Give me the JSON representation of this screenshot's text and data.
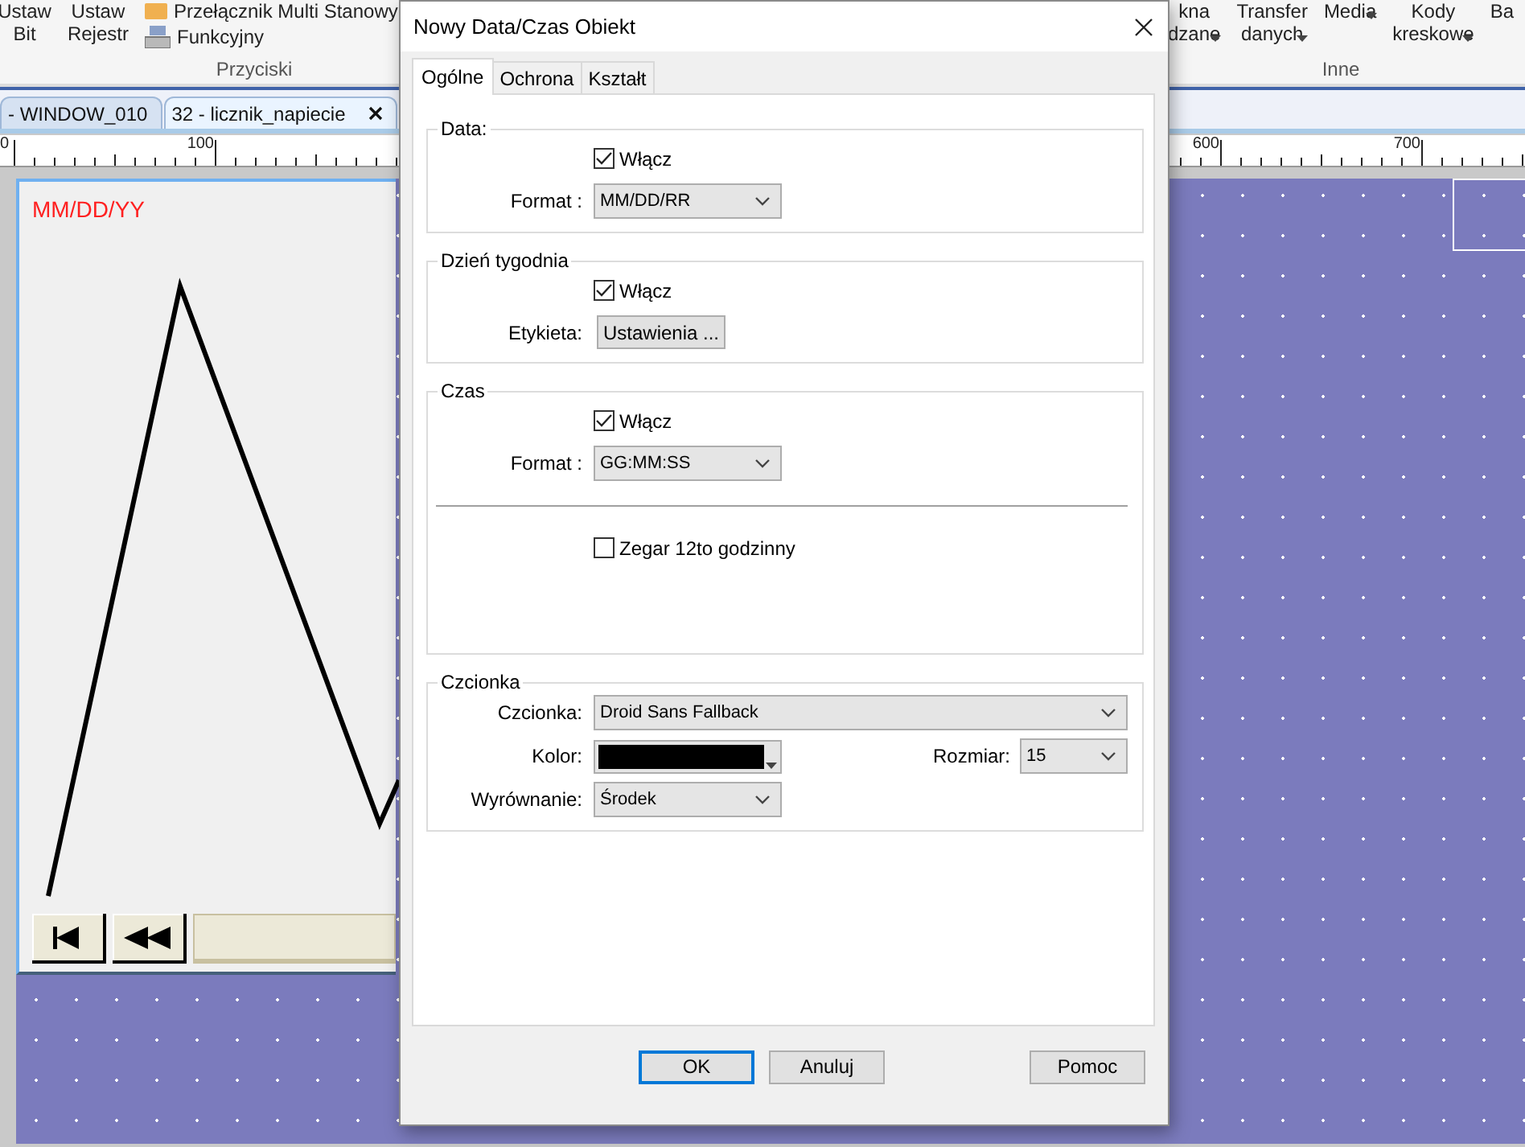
{
  "ribbon": {
    "left_buttons": [
      {
        "lines": [
          "Ustaw",
          "Bit"
        ]
      },
      {
        "lines": [
          "Ustaw",
          "Rejestr"
        ]
      }
    ],
    "small_buttons": [
      "Przełącznik Multi Stanowy",
      "Funkcyjny"
    ],
    "left_group_label": "Przyciski",
    "right_buttons": [
      {
        "lines": [
          "kna",
          "dzane"
        ],
        "dropdown": true
      },
      {
        "lines": [
          "Transfer",
          "danych"
        ],
        "dropdown": true
      },
      {
        "lines": [
          "Media"
        ],
        "dropdown": true
      },
      {
        "lines": [
          "Kody",
          "kreskowe"
        ],
        "dropdown": true
      },
      {
        "lines": [
          "Ba"
        ],
        "dropdown": false
      }
    ],
    "right_group_label": "Inne"
  },
  "doc_tabs": [
    {
      "label": "- WINDOW_010",
      "selected": false
    },
    {
      "label": "32 - licznik_napiecie",
      "selected": true
    }
  ],
  "ruler": {
    "labels": [
      "0",
      "100",
      "600",
      "700"
    ]
  },
  "canvas": {
    "date_text": "MM/DD/YY"
  },
  "dialog": {
    "title": "Nowy Data/Czas Obiekt",
    "tabs": [
      {
        "label": "Ogólne",
        "selected": true
      },
      {
        "label": "Ochrona",
        "selected": false
      },
      {
        "label": "Kształt",
        "selected": false
      }
    ],
    "groups": [
      {
        "legend": "Data:",
        "rows": [
          {
            "kind": "checkbox",
            "label": "Włącz",
            "checked": true
          },
          {
            "kind": "select",
            "label": "Format :",
            "value": "MM/DD/RR"
          }
        ]
      },
      {
        "legend": "Dzień tygodnia",
        "rows": [
          {
            "kind": "checkbox",
            "label": "Włącz",
            "checked": true
          },
          {
            "kind": "button",
            "label": "Etykieta:",
            "value": "Ustawienia ..."
          }
        ]
      },
      {
        "legend": "Czas",
        "rows": [
          {
            "kind": "checkbox",
            "label": "Włącz",
            "checked": true
          },
          {
            "kind": "select",
            "label": "Format :",
            "value": "GG:MM:SS"
          },
          {
            "kind": "separator"
          },
          {
            "kind": "checkbox",
            "label": "Zegar 12to godzinny",
            "checked": false
          }
        ]
      },
      {
        "legend": "Czcionka",
        "rows": [
          {
            "kind": "select",
            "label": "Czcionka:",
            "value": "Droid Sans Fallback",
            "wide": true
          },
          {
            "kind": "color",
            "label": "Kolor:",
            "color": "#000000",
            "size": {
              "label": "Rozmiar:",
              "value": "15"
            }
          },
          {
            "kind": "select",
            "label": "Wyrównanie:",
            "value": "Środek"
          }
        ]
      }
    ],
    "buttons": [
      {
        "label": "OK",
        "default": true
      },
      {
        "label": "Anuluj",
        "default": false
      },
      {
        "label": "Pomoc",
        "default": false
      }
    ]
  }
}
